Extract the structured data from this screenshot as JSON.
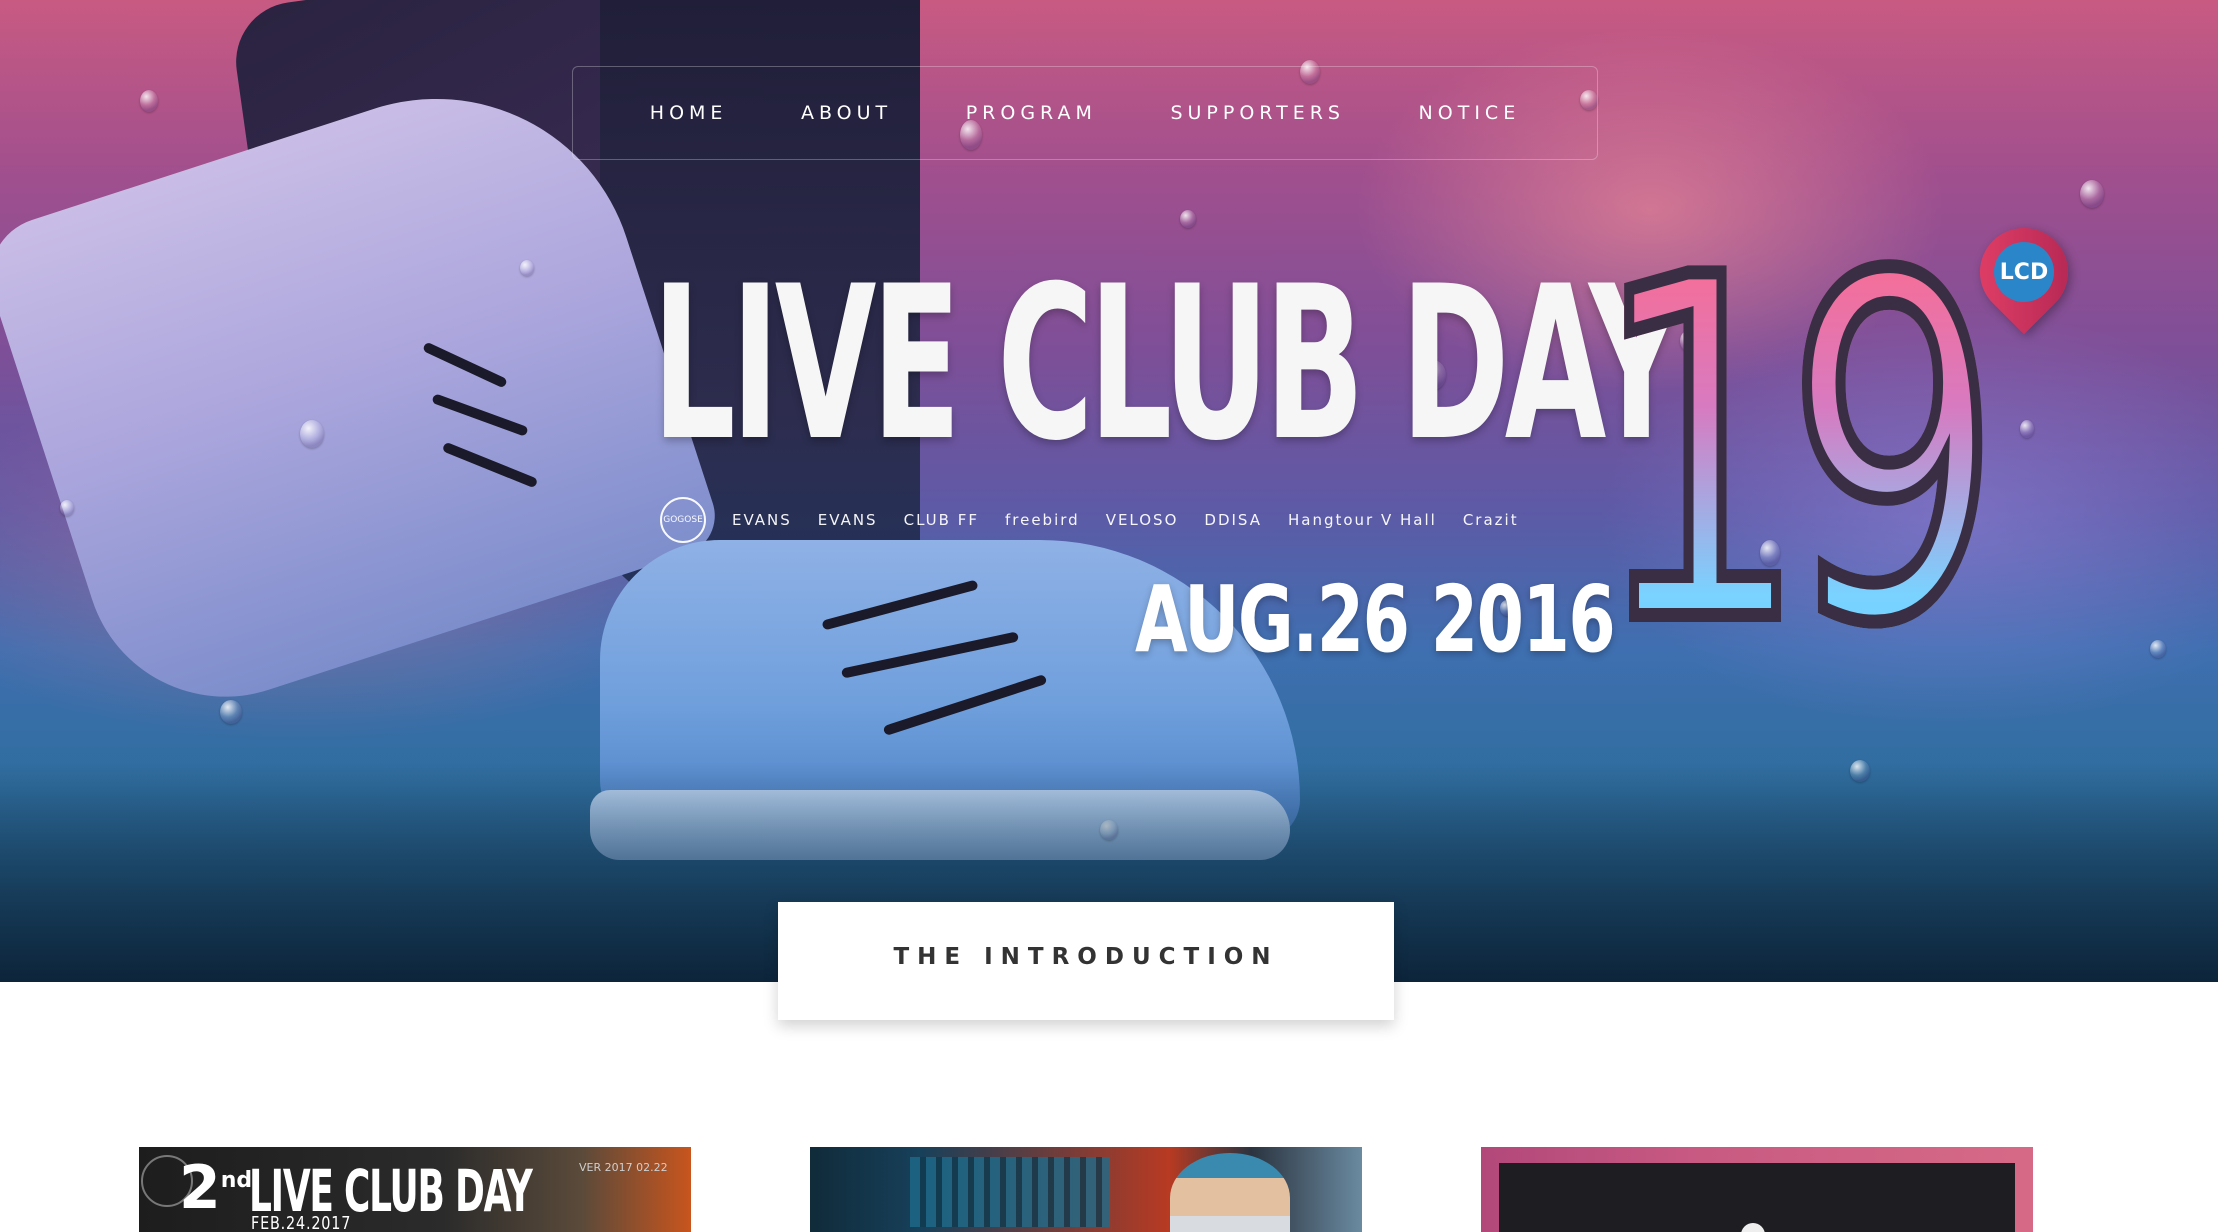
{
  "nav": {
    "items": [
      {
        "label": "HOME"
      },
      {
        "label": "ABOUT"
      },
      {
        "label": "PROGRAM"
      },
      {
        "label": "SUPPORTERS"
      },
      {
        "label": "NOTICE"
      }
    ]
  },
  "hero": {
    "title": "LIVE CLUB DAY",
    "number": "19",
    "date": "AUG.26 2016",
    "pin_logo": "LCD",
    "sponsors": [
      "GOGOSE",
      "EVANS",
      "EVANS",
      "CLUB FF",
      "freebird",
      "VELOSO",
      "DDISA",
      "Hangtour V Hall",
      "Crazit"
    ]
  },
  "intro": {
    "label": "THE INTRODUCTION"
  },
  "cards": [
    {
      "num": "2",
      "suffix": "nd",
      "title": "LIVE CLUB DAY",
      "date": "FEB.24.2017",
      "ver": "VER 2017 02.22"
    },
    {},
    {}
  ],
  "colors": {
    "hero_top": "#c85a82",
    "hero_bottom": "#1d4a6a",
    "pin": "#e54168"
  }
}
